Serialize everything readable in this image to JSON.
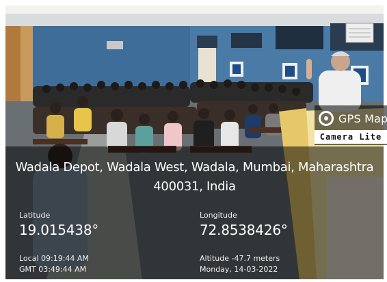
{
  "badge": {
    "icon": "map-pin-icon",
    "title": "GPS Map",
    "subtitle": "Camera Lite"
  },
  "location": {
    "address": "Wadala Depot, Wadala West, Wadala, Mumbai, Maharashtra 400031, India"
  },
  "coordinates": {
    "latitude_label": "Latitude",
    "latitude_value": "19.015438°",
    "longitude_label": "Longitude",
    "longitude_value": "72.8538426°"
  },
  "details": {
    "local_time": "Local 09:19:44 AM",
    "gmt_time": "GMT 03:49:44 AM",
    "altitude": "Altitude -47.7 meters",
    "date": "Monday, 14-03-2022"
  },
  "colors": {
    "overlay": "#000000",
    "text": "#ffffff",
    "wall": "#3f6f99",
    "podium": "#f2d98a"
  }
}
